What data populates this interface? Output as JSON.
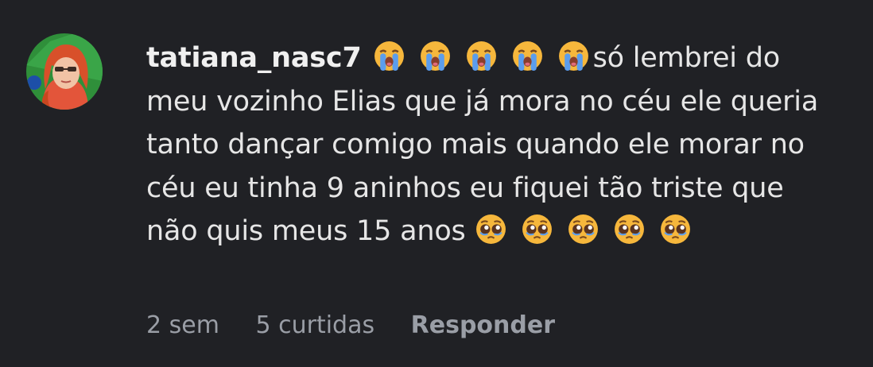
{
  "comment": {
    "username": "tatiana_nasc7",
    "leading_emojis": [
      "loudly-crying-face",
      "loudly-crying-face",
      "loudly-crying-face",
      "loudly-crying-face",
      "loudly-crying-face"
    ],
    "text": "só lembrei do meu vozinho Elias que já mora no céu ele queria tanto dançar comigo mais quando ele morar no céu eu tinha 9 aninhos eu fiquei tão triste que não quis meus 15 anos",
    "trailing_emojis": [
      "pleading-face",
      "pleading-face",
      "pleading-face",
      "pleading-face",
      "pleading-face"
    ],
    "time": "2 sem",
    "likes": "5 curtidas",
    "reply_label": "Responder"
  },
  "colors": {
    "background": "#202125",
    "text": "#e6e6e6",
    "meta": "#9a9ea6"
  }
}
